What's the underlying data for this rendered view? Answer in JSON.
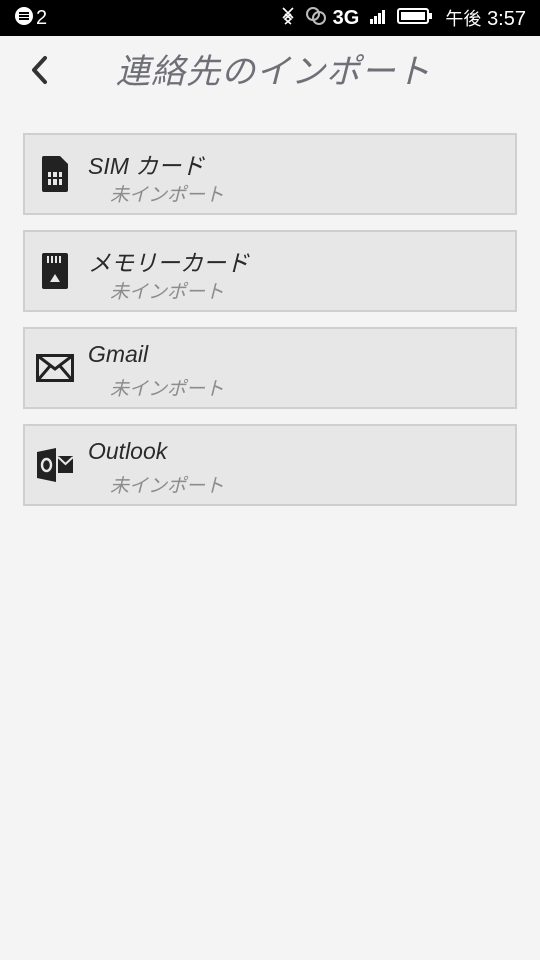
{
  "status_bar": {
    "notification_count": "2",
    "network_type": "3G",
    "am_pm": "午後",
    "time": "3:57",
    "icons": [
      "notification-icon",
      "bluetooth-icon",
      "link-icon",
      "signal-icon",
      "battery-icon"
    ]
  },
  "header": {
    "title": "連絡先のインポート",
    "back_icon": "chevron-left-icon"
  },
  "import_sources": [
    {
      "label": "SIM カード",
      "status": "未インポート",
      "icon": "sim-card-icon"
    },
    {
      "label": "メモリーカード",
      "status": "未インポート",
      "icon": "memory-card-icon"
    },
    {
      "label": "Gmail",
      "status": "未インポート",
      "icon": "mail-icon"
    },
    {
      "label": "Outlook",
      "status": "未インポート",
      "icon": "outlook-icon"
    }
  ],
  "colors": {
    "background": "#f4f4f4",
    "item_background": "#e7e7e7",
    "item_border": "#cfcfcf",
    "title": "#6f6f78",
    "status_text": "#8c8c8c"
  }
}
